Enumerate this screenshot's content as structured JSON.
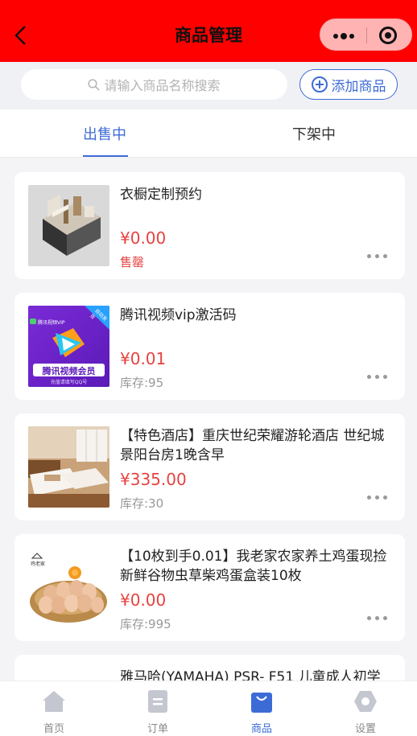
{
  "navbar": {
    "title": "商品管理"
  },
  "search": {
    "placeholder": "请输入商品名称搜索",
    "add_label": "添加商品"
  },
  "tabs": [
    {
      "label": "出售中"
    },
    {
      "label": "下架中"
    }
  ],
  "products": [
    {
      "name": "衣橱定制预约",
      "price": "¥0.00",
      "stock": "售罄",
      "image": "wardrobe-render"
    },
    {
      "name": "腾讯视频vip激活码",
      "price": "¥0.01",
      "stock": "库存:95",
      "image": "tencent-video-vip-card",
      "image_text": {
        "top": "腾讯视频VIP",
        "badge": "自动发货",
        "main": "腾讯视频会员",
        "sub": "充值请填写QQ号"
      }
    },
    {
      "name": "【特色酒店】重庆世纪荣耀游轮酒店 世纪城景阳台房1晚含早",
      "price": "¥335.00",
      "stock": "库存:30",
      "image": "hotel-room"
    },
    {
      "name": "【10枚到手0.01】我老家农家养土鸡蛋现捡新鲜谷物虫草柴鸡蛋盒装10枚",
      "price": "¥0.00",
      "stock": "库存:995",
      "image": "eggs-basket",
      "image_text": {
        "logo": "鸡老家"
      }
    },
    {
      "name": "雅马哈(YAMAHA) PSR- F51 儿童成人初学"
    }
  ],
  "tabbar": [
    {
      "label": "首页",
      "icon": "home-icon"
    },
    {
      "label": "订单",
      "icon": "order-icon"
    },
    {
      "label": "商品",
      "icon": "bag-icon",
      "active": true
    },
    {
      "label": "设置",
      "icon": "gear-icon"
    }
  ],
  "colors": {
    "navbar": "#fe0000",
    "accent": "#3d6bd6",
    "price": "#e64340"
  }
}
